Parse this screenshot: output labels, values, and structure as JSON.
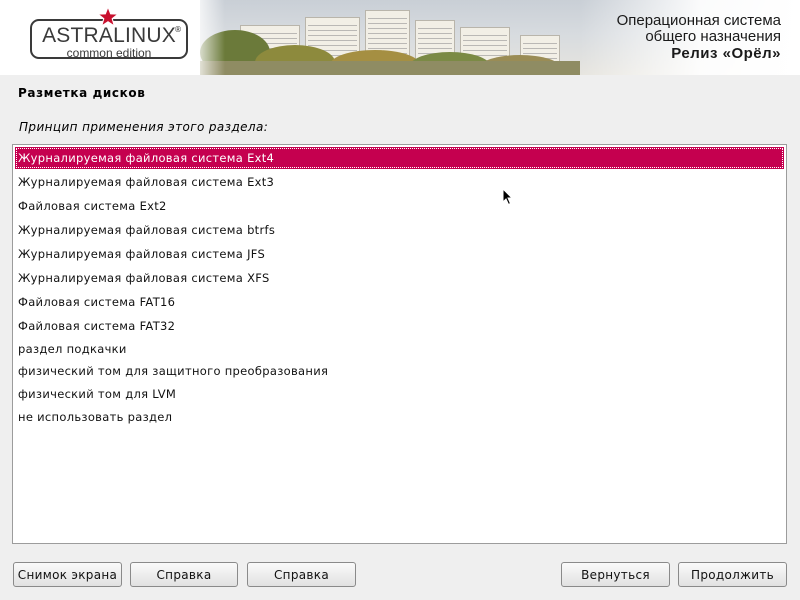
{
  "header": {
    "logo_title": "ASTRALINUX",
    "logo_subtitle": "common edition",
    "logo_reg": "®",
    "os_line1": "Операционная система",
    "os_line2": "общего назначения",
    "release": "Релиз «Орёл»"
  },
  "page": {
    "title": "Разметка дисков",
    "prompt": "Принцип применения этого раздела:"
  },
  "list": {
    "selected_index": 0,
    "items": [
      "Журналируемая файловая система Ext4",
      "Журналируемая файловая система Ext3",
      "Файловая система Ext2",
      "Журналируемая файловая система btrfs",
      "Журналируемая файловая система JFS",
      "Журналируемая файловая система XFS",
      "Файловая система FAT16",
      "Файловая система FAT32",
      "раздел подкачки",
      "физический том для защитного преобразования",
      "физический том для LVM",
      "не использовать раздел"
    ]
  },
  "buttons": {
    "screenshot": "Снимок экрана",
    "help1": "Справка",
    "help2": "Справка",
    "back": "Вернуться",
    "continue": "Продолжить"
  },
  "colors": {
    "selection": "#c5004f",
    "logo_star": "#c8102e"
  }
}
